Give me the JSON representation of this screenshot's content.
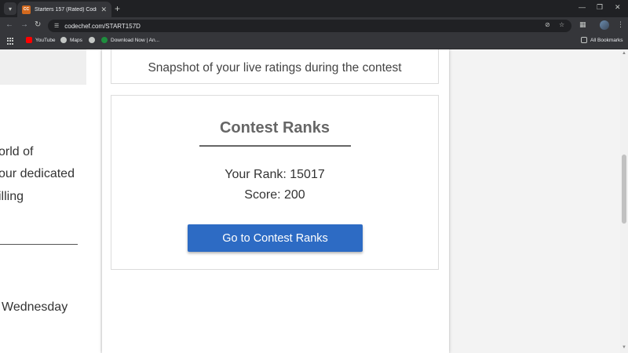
{
  "browser": {
    "tab_title": "Starters 157 (Rated) Coding Co",
    "favicon_text": "CC",
    "url": "codechef.com/START157D",
    "bookmarks": [
      {
        "label": "YouTube",
        "icon": "youtube-icon",
        "color": "#ff0000"
      },
      {
        "label": "Maps",
        "icon": "maps-icon",
        "color": "#c4c7c5"
      },
      {
        "label": "",
        "icon": "globe-icon",
        "color": "#c4c7c5"
      },
      {
        "label": "Download Now | An...",
        "icon": "download-site-icon",
        "color": "#1e8e3e"
      }
    ],
    "all_bookmarks": "All Bookmarks"
  },
  "left": {
    "lines": [
      "orld of",
      "our dedicated",
      "illing",
      "Wednesday"
    ]
  },
  "snapshot": {
    "text": "Snapshot of your live ratings during the contest"
  },
  "ranks": {
    "title": "Contest Ranks",
    "rank_line": "Your Rank: 15017",
    "score_line": "Score: 200",
    "button_label": "Go to Contest Ranks"
  },
  "colors": {
    "button": "#2d6bc4",
    "chrome_dark": "#202124",
    "chrome_mid": "#35363a"
  }
}
